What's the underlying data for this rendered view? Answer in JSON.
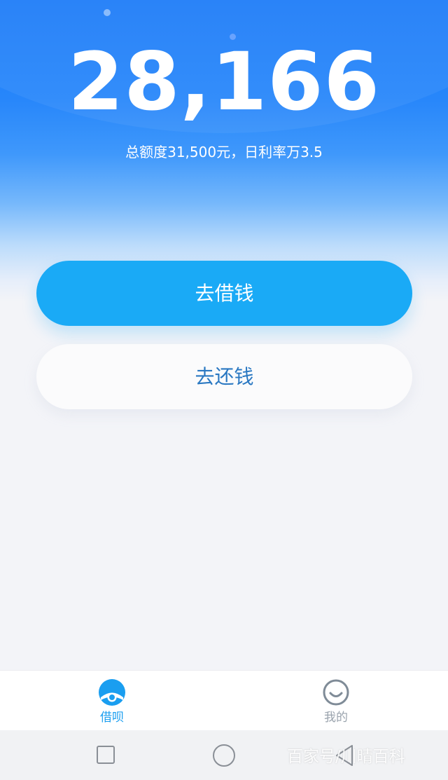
{
  "credit": {
    "available_amount": "28,166",
    "summary": "总额度31,500元，日利率万3.5"
  },
  "actions": {
    "borrow_label": "去借钱",
    "repay_label": "去还钱"
  },
  "colors": {
    "brand_blue": "#1d7cf8",
    "button_blue": "#1aaaf6",
    "repay_text": "#2a78c2",
    "tab_active": "#1a9ef0",
    "tab_inactive": "#9aa3ad"
  },
  "tabbar": {
    "items": [
      {
        "label": "借呗",
        "icon": "jiebei-logo-icon",
        "active": true
      },
      {
        "label": "我的",
        "icon": "smiley-profile-icon",
        "active": false
      }
    ]
  },
  "system_nav": {
    "buttons": [
      "recent-apps-icon",
      "home-icon",
      "back-icon"
    ]
  },
  "watermark": {
    "text": "百家号/川晴百科"
  }
}
